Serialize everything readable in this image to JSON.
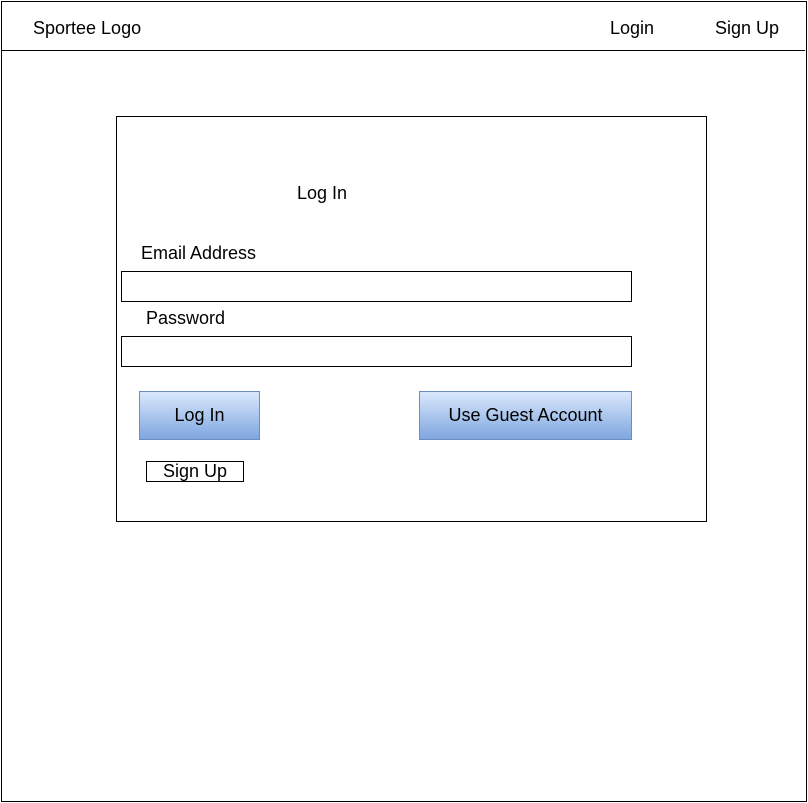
{
  "header": {
    "logo_text": "Sportee Logo",
    "nav": {
      "login_label": "Login",
      "signup_label": "Sign Up"
    }
  },
  "login_card": {
    "title": "Log In",
    "email": {
      "label": "Email Address",
      "value": "",
      "placeholder": ""
    },
    "password": {
      "label": "Password",
      "value": "",
      "placeholder": ""
    },
    "login_button_label": "Log In",
    "guest_button_label": "Use Guest Account",
    "signup_button_label": "Sign Up"
  },
  "colors": {
    "button_fill_top": "#dae8fc",
    "button_fill_bottom": "#7ea6e0",
    "button_border": "#6c8ebf"
  }
}
